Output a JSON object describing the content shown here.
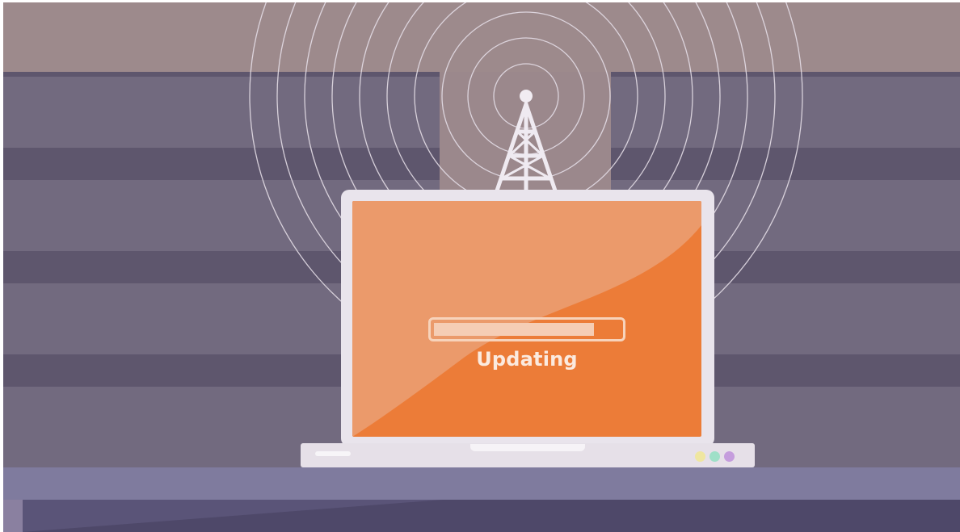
{
  "screen": {
    "status_text": "Updating",
    "progress": 0.86
  },
  "colors": {
    "screen_orange": "#ec7c38",
    "screen_highlight": "#eb9a6b",
    "laptop_body": "#e9e4ec",
    "wall_pink": "#9d8a8c",
    "wall_purple": "#6e6679",
    "shelf_purple": "#7f7b9e",
    "indicator_yellow": "#efe6a0",
    "indicator_green": "#9fe0c8",
    "indicator_purple": "#c59ddd"
  },
  "icons": {
    "tower": "radio-tower-icon",
    "waves": "signal-waves-icon"
  }
}
